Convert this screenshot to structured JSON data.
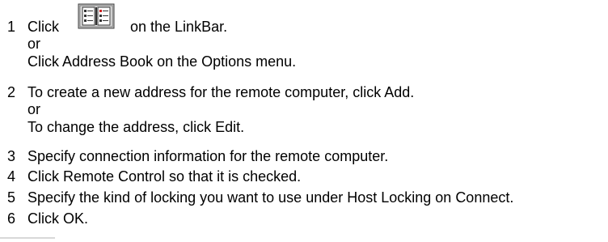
{
  "steps": [
    {
      "number": "1",
      "before_icon": "Click",
      "icon": "address-book-icon",
      "after_icon": "on the LinkBar.",
      "or": "or",
      "alt": "Click Address Book on the Options menu."
    },
    {
      "number": "2",
      "text": "To create a new address for the remote computer, click Add.",
      "or": "or",
      "alt": "To change the address, click Edit."
    },
    {
      "number": "3",
      "text": "Specify connection information for the remote computer."
    },
    {
      "number": "4",
      "text": "Click Remote Control so that it is checked."
    },
    {
      "number": "5",
      "text": "Specify the kind of locking you want to use under Host Locking on Connect."
    },
    {
      "number": "6",
      "text": "Click OK."
    }
  ],
  "colors": {
    "text": "#000000",
    "icon_frame": "#404040",
    "icon_fill": "#e6e6e6",
    "icon_red": "#d02020"
  }
}
